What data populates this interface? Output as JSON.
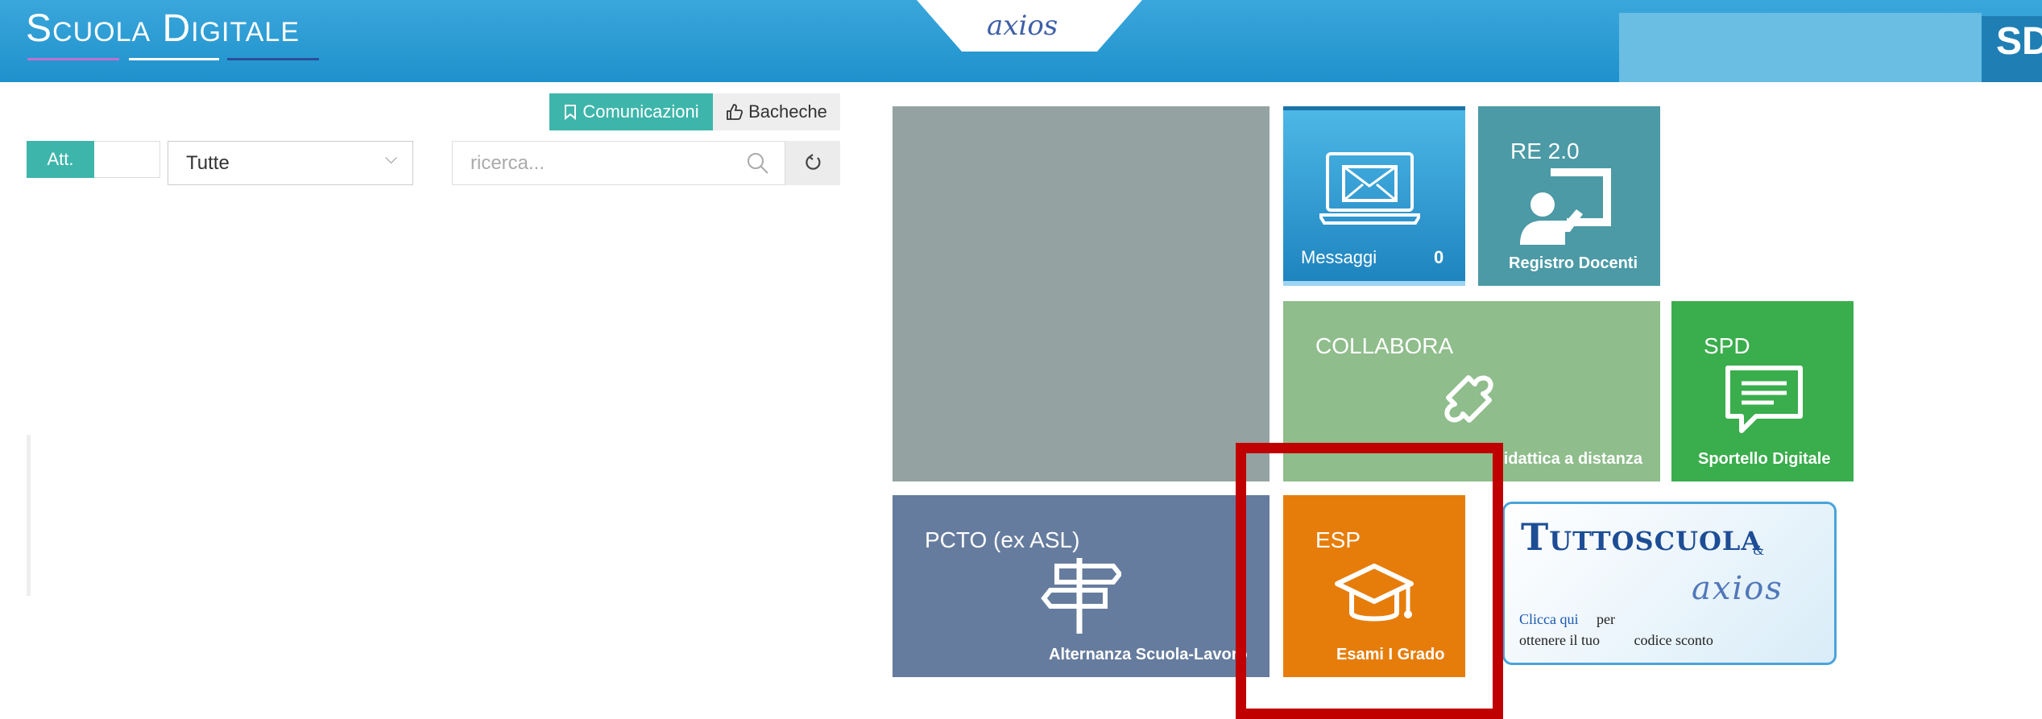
{
  "header": {
    "logo": "Scuola Digitale",
    "center_logo": "axios",
    "badge": "SD"
  },
  "toolbar": {
    "tab_comunicazioni": "Comunicazioni",
    "tab_bacheche": "Bacheche",
    "att_label": "Att.",
    "filter_value": "Tutte",
    "search_placeholder": "ricerca..."
  },
  "tiles": {
    "messaggi": {
      "label": "Messaggi",
      "count": "0"
    },
    "re": {
      "title": "RE 2.0",
      "label": "Registro Docenti"
    },
    "collabora": {
      "title": "COLLABORA",
      "label": "Didattica a distanza"
    },
    "spd": {
      "title": "SPD",
      "label": "Sportello Digitale"
    },
    "pcto": {
      "title": "PCTO (ex ASL)",
      "label": "Alternanza Scuola-Lavoro"
    },
    "esp": {
      "title": "ESP",
      "label": "Esami I Grado"
    }
  },
  "ad": {
    "brand": "Tuttoscuola",
    "amp": "&",
    "partner": "axios",
    "link_text": "Clicca qui",
    "text_a": "per",
    "text_b": "ottenere il tuo",
    "text_c": "codice sconto"
  }
}
